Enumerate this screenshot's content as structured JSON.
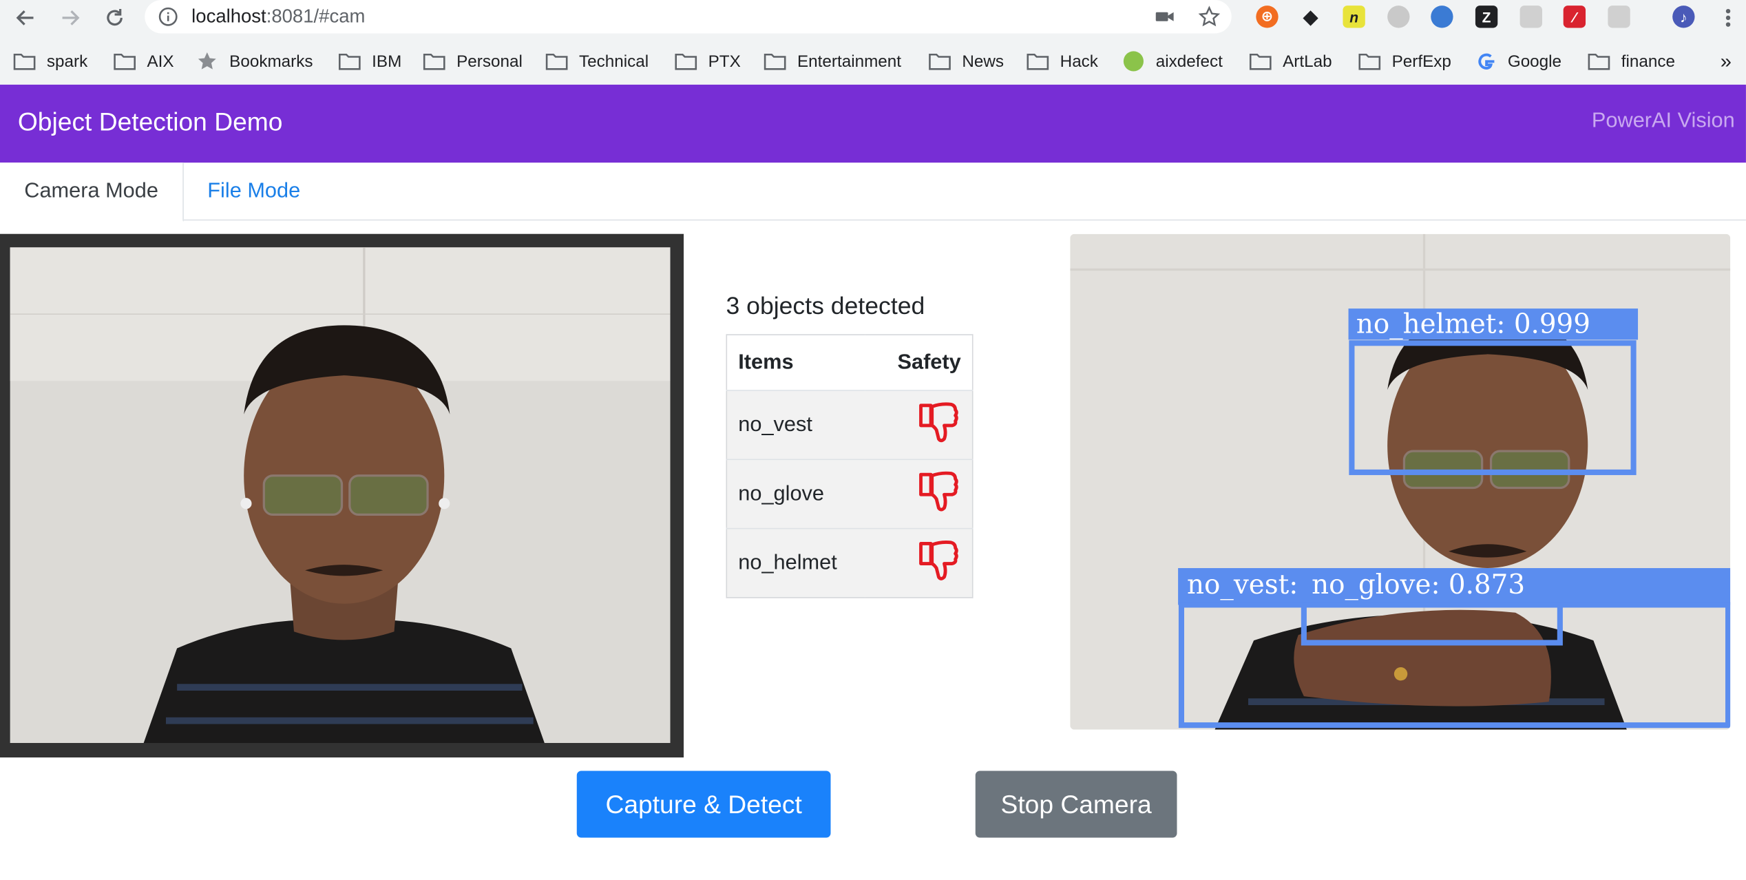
{
  "browser": {
    "url_host": "localhost",
    "url_rest": ":8081/#cam",
    "bookmarks": [
      "spark",
      "AIX",
      "Bookmarks",
      "IBM",
      "Personal",
      "Technical",
      "PTX",
      "Entertainment",
      "News",
      "Hack",
      "aixdefect",
      "ArtLab",
      "PerfExp",
      "Google",
      "finance"
    ],
    "overflow": "»"
  },
  "app": {
    "title": "Object Detection Demo",
    "brand_right": "PowerAI Vision"
  },
  "tabs": [
    {
      "label": "Camera Mode",
      "active": true
    },
    {
      "label": "File Mode",
      "active": false
    }
  ],
  "results": {
    "title": "3 objects detected",
    "columns": [
      "Items",
      "Safety"
    ],
    "rows": [
      {
        "item": "no_vest",
        "safety": "thumbs-down"
      },
      {
        "item": "no_glove",
        "safety": "thumbs-down"
      },
      {
        "item": "no_helmet",
        "safety": "thumbs-down"
      }
    ]
  },
  "detections": [
    {
      "label": "no_helmet: 0.999"
    },
    {
      "label": "no_vest:"
    },
    {
      "label": "no_glove: 0.873"
    }
  ],
  "buttons": {
    "capture": "Capture & Detect",
    "stop": "Stop Camera"
  },
  "colors": {
    "appbar": "#772ed5",
    "primary": "#1a82fb",
    "secondary": "#6c757d",
    "thumbs_down": "#e41b23",
    "detection_box": "#5b8def"
  }
}
